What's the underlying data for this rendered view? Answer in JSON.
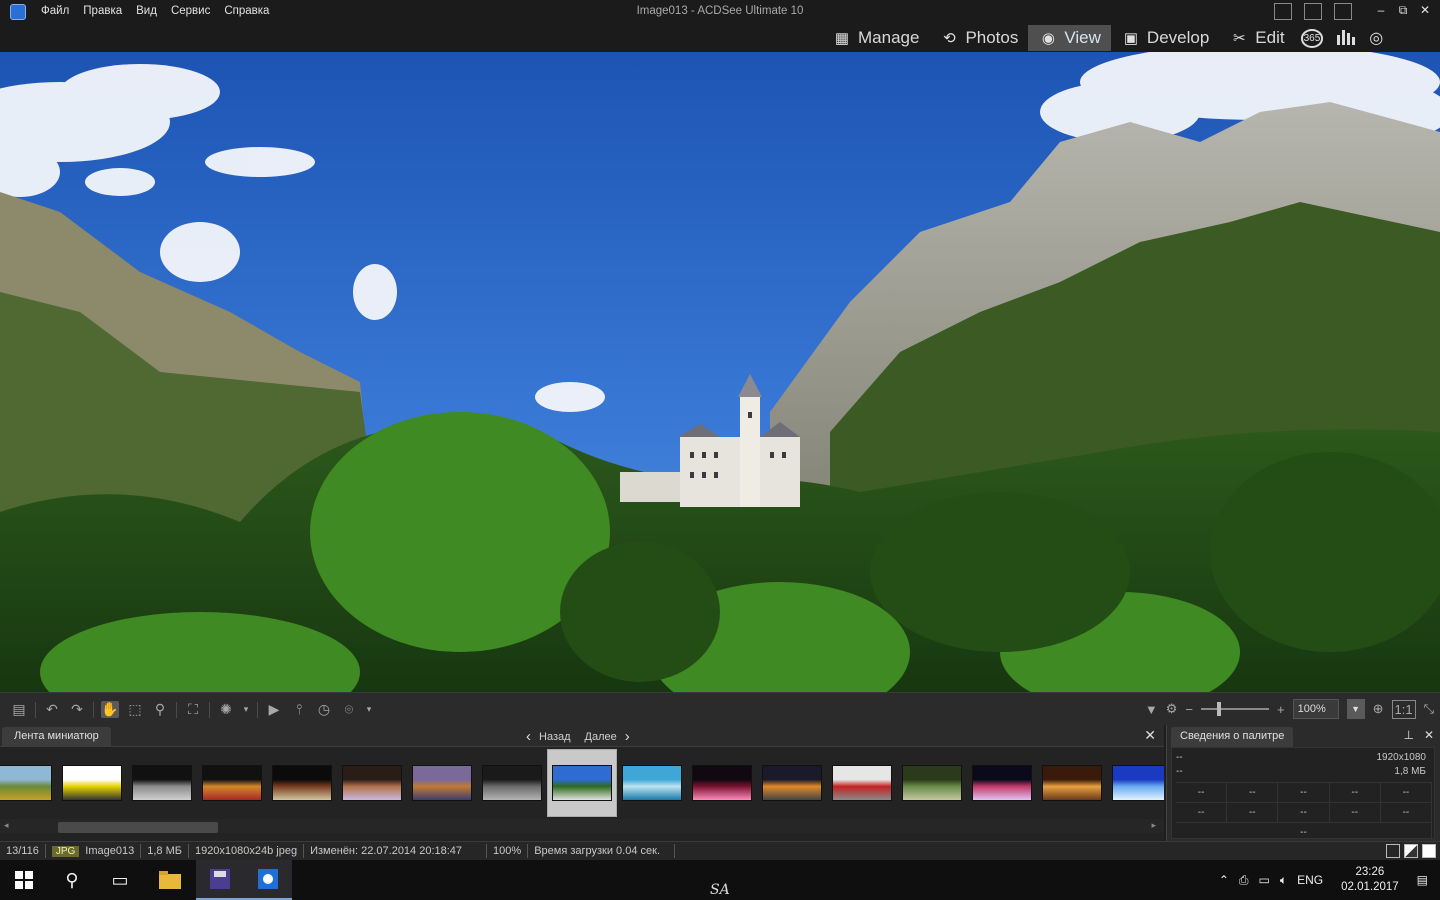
{
  "window": {
    "title": "Image013 - ACDSee Ultimate 10",
    "menu": [
      "Файл",
      "Правка",
      "Вид",
      "Сервис",
      "Справка"
    ],
    "controls": [
      "–",
      "⧉",
      "✕"
    ]
  },
  "modes": [
    {
      "label": "Manage",
      "icon": "grid-icon",
      "glyph": "▦",
      "active": false
    },
    {
      "label": "Photos",
      "icon": "photos-icon",
      "glyph": "⟲",
      "active": false
    },
    {
      "label": "View",
      "icon": "eye-icon",
      "glyph": "◉",
      "active": true
    },
    {
      "label": "Develop",
      "icon": "develop-icon",
      "glyph": "▣",
      "active": false
    },
    {
      "label": "Edit",
      "icon": "edit-icon",
      "glyph": "✂",
      "active": false
    }
  ],
  "mode_extra": {
    "badge_365": "365",
    "histogram_icon": "▮",
    "eye_icon": "◎"
  },
  "toolbar": {
    "zoom_value": "100%",
    "zoom_level": 0.25,
    "one_to_one": "1:1"
  },
  "filmstrip": {
    "tab_label": "Лента миниатюр",
    "back_label": "Назад",
    "next_label": "Далее",
    "thumbnails": [
      {
        "colors": [
          "#8fb7d6",
          "#6a8a34",
          "#c7a12a"
        ]
      },
      {
        "colors": [
          "#ffffff",
          "#e6d200",
          "#333333"
        ]
      },
      {
        "colors": [
          "#111111",
          "#8c8c8c",
          "#cfcfcf"
        ]
      },
      {
        "colors": [
          "#111111",
          "#d4882a",
          "#a52828"
        ]
      },
      {
        "colors": [
          "#0b0b0b",
          "#7a3d1f",
          "#d0c5a0"
        ]
      },
      {
        "colors": [
          "#2a1c16",
          "#b3714b",
          "#c9b8e0"
        ]
      },
      {
        "colors": [
          "#7a6a9a",
          "#c07a35",
          "#3e3e6e"
        ]
      },
      {
        "colors": [
          "#1a1a1a",
          "#6a6a6a",
          "#b5b5b5"
        ]
      },
      {
        "colors": [
          "#2f6bd1",
          "#2e6a1d",
          "#e2e2e2"
        ]
      },
      {
        "colors": [
          "#3fa7d8",
          "#bde3f2",
          "#1a7aa8"
        ]
      },
      {
        "colors": [
          "#120812",
          "#7a1230",
          "#ff8bbd"
        ]
      },
      {
        "colors": [
          "#1a1a2a",
          "#e08a2a",
          "#444444"
        ]
      },
      {
        "colors": [
          "#e6e6e6",
          "#c22222",
          "#8a8a8a"
        ]
      },
      {
        "colors": [
          "#2a3a1a",
          "#6a8a4a",
          "#c6c6a0"
        ]
      },
      {
        "colors": [
          "#0a0a1a",
          "#c23a6a",
          "#e2c2f2"
        ]
      },
      {
        "colors": [
          "#3a1a0a",
          "#e8a040",
          "#6a3a1a"
        ]
      },
      {
        "colors": [
          "#1a3ac2",
          "#6aaaf2",
          "#e2f2ff"
        ]
      }
    ],
    "selected_index": 8
  },
  "palette": {
    "tab_label": "Сведения о палитре",
    "resolution": "1920x1080",
    "size": "1,8 МБ",
    "left_top": "--",
    "left_bottom": "--",
    "grid": [
      [
        "--",
        "--",
        "--",
        "--",
        "--"
      ],
      [
        "--",
        "--",
        "--",
        "--",
        "--"
      ]
    ],
    "bottom": "--"
  },
  "status": {
    "position": "13/116",
    "format": "JPG",
    "filename": "Image013",
    "filesize": "1,8 МБ",
    "dimensions": "1920x1080x24b jpeg",
    "modified": "Изменён: 22.07.2014 20:18:47",
    "zoom": "100%",
    "load_time": "Время загрузки 0.04 сек."
  },
  "taskbar": {
    "lang": "ENG",
    "time": "23:26",
    "date": "02.01.2017",
    "watermark": "SA"
  }
}
